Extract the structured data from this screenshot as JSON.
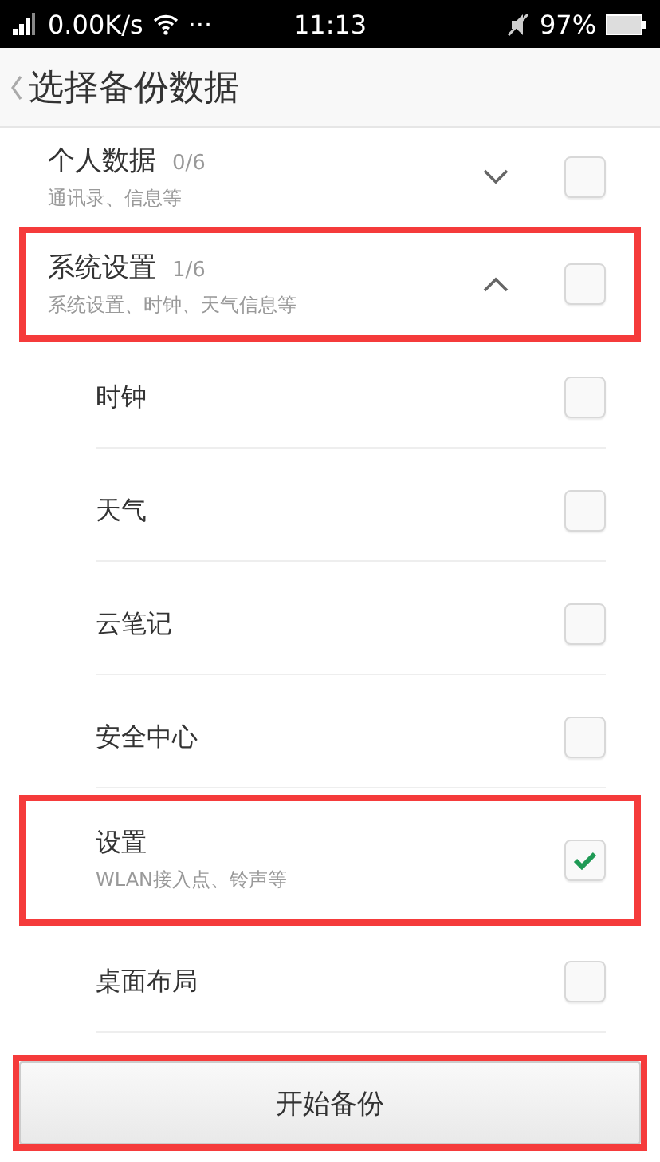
{
  "status_bar": {
    "network_speed": "0.00K/s",
    "more": "···",
    "time": "11:13",
    "battery": "97%"
  },
  "header": {
    "title": "选择备份数据"
  },
  "groups": [
    {
      "title": "个人数据",
      "count": "0/6",
      "subtitle": "通讯录、信息等",
      "expanded": false,
      "checked": false,
      "highlighted": false
    },
    {
      "title": "系统设置",
      "count": "1/6",
      "subtitle": "系统设置、时钟、天气信息等",
      "expanded": true,
      "checked": false,
      "highlighted": true,
      "children": [
        {
          "title": "时钟",
          "checked": false,
          "highlighted": false
        },
        {
          "title": "天气",
          "checked": false,
          "highlighted": false
        },
        {
          "title": "云笔记",
          "checked": false,
          "highlighted": false
        },
        {
          "title": "安全中心",
          "checked": false,
          "highlighted": false
        },
        {
          "title": "设置",
          "subtitle": "WLAN接入点、铃声等",
          "checked": true,
          "highlighted": true
        },
        {
          "title": "桌面布局",
          "checked": false,
          "highlighted": false
        }
      ]
    }
  ],
  "button": {
    "label": "开始备份",
    "highlighted": true
  }
}
